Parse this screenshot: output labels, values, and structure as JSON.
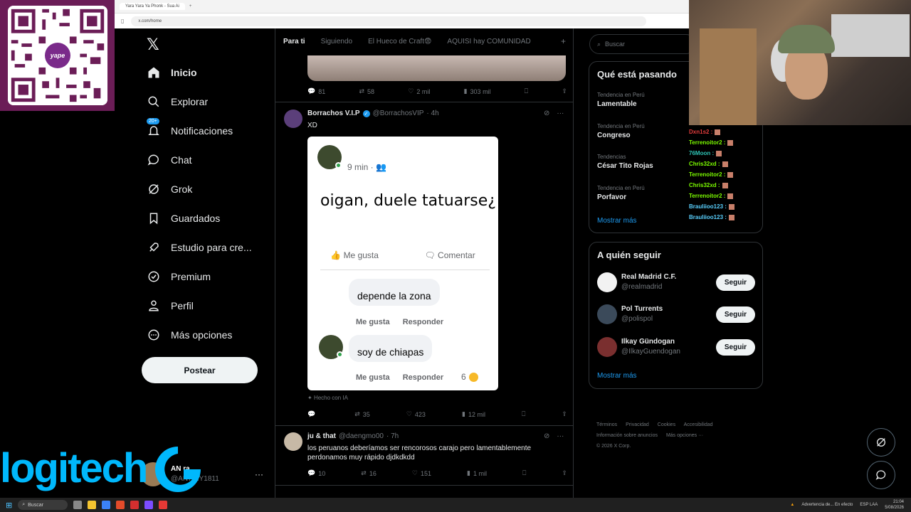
{
  "browser": {
    "tab_title": "Yara Yara Ya Phonk - Sua Ai",
    "url": "x.com/home"
  },
  "qr": {
    "logo_text": "yape"
  },
  "nav": {
    "items": [
      {
        "label": "Inicio",
        "icon": "home-icon"
      },
      {
        "label": "Explorar",
        "icon": "search-icon"
      },
      {
        "label": "Notificaciones",
        "icon": "bell-icon",
        "badge": "20+"
      },
      {
        "label": "Chat",
        "icon": "chat-icon"
      },
      {
        "label": "Grok",
        "icon": "grok-icon"
      },
      {
        "label": "Guardados",
        "icon": "bookmark-icon"
      },
      {
        "label": "Estudio para cre...",
        "icon": "rocket-icon"
      },
      {
        "label": "Premium",
        "icon": "premium-icon"
      },
      {
        "label": "Perfil",
        "icon": "person-icon"
      },
      {
        "label": "Más opciones",
        "icon": "more-circle-icon"
      }
    ],
    "post_label": "Postear",
    "account_name": "AN      ra",
    "account_handle": "@AN7       NY1811"
  },
  "tabs": [
    "Para ti",
    "Siguiendo",
    "El Hueco de Craft😨",
    "AQUISI hay COMUNIDAD"
  ],
  "tweets": [
    {
      "actions": {
        "replies": "81",
        "retweets": "58",
        "likes": "2 mil",
        "views": "303 mil"
      }
    },
    {
      "name": "Borrachos V.I.P",
      "handle": "@BorrachosVIP",
      "time": "· 4h",
      "text": "XD",
      "ai_tag": "Hecho con IA",
      "actions": {
        "replies": "",
        "retweets": "35",
        "likes": "423",
        "views": "12 mil"
      },
      "fb": {
        "time": "9 min ·",
        "post_text": "oigan, duele tatuarse¿",
        "like": "Me gusta",
        "comment": "Comentar",
        "comment1": "depende la zona",
        "comment2": "soy de chiapas",
        "reply_like": "Me gusta",
        "reply": "Responder",
        "reactions": "6"
      }
    },
    {
      "name": "ju & that",
      "handle": "@daengmo00",
      "time": "· 7h",
      "text": "los peruanos deberíamos ser rencorosos carajo pero lamentablemente perdonamos muy rápido djdkdkdd",
      "actions": {
        "replies": "10",
        "retweets": "16",
        "likes": "151",
        "views": "1 mil"
      }
    }
  ],
  "search": {
    "placeholder": "Buscar"
  },
  "trends": {
    "title": "Qué está pasando",
    "items": [
      {
        "context": "Tendencia en Perú",
        "topic": "Lamentable"
      },
      {
        "context": "Tendencia en Perú",
        "topic": "Congreso"
      },
      {
        "context": "Tendencias",
        "topic": "César Tito Rojas"
      },
      {
        "context": "Tendencia en Perú",
        "topic": "Porfavor"
      }
    ],
    "show_more": "Mostrar más"
  },
  "who_to_follow": {
    "title": "A quién seguir",
    "items": [
      {
        "name": "Real Madrid C.F.",
        "handle": "@realmadrid",
        "button": "Seguir"
      },
      {
        "name": "Pol Turrents",
        "handle": "@polispol",
        "button": "Seguir"
      },
      {
        "name": "Ilkay Gündogan",
        "handle": "@IlkayGuendogan",
        "button": "Seguir"
      }
    ],
    "show_more": "Mostrar más"
  },
  "footer": {
    "links": [
      "Términos",
      "Privacidad",
      "Cookies",
      "Accesibilidad",
      "Información sobre anuncios",
      "Más opciones ···"
    ],
    "copyright": "© 2026 X Corp."
  },
  "chat_overlay": [
    {
      "user": "Dxn1s2 :",
      "color": "#e23c3c"
    },
    {
      "user": "Terrenoitor2 :",
      "color": "#7cfc00"
    },
    {
      "user": "76Moon :",
      "color": "#2ec4b6"
    },
    {
      "user": "Chris32xd :",
      "color": "#7cfc00"
    },
    {
      "user": "Terrenoitor2 :",
      "color": "#7cfc00"
    },
    {
      "user": "Chris32xd :",
      "color": "#7cfc00"
    },
    {
      "user": "Terrenoitor2 :",
      "color": "#7cfc00"
    },
    {
      "user": "Brauliioo123 :",
      "color": "#5ad1ff"
    },
    {
      "user": "Brauliioo123 :",
      "color": "#5ad1ff"
    }
  ],
  "logitech": {
    "text": "logitech"
  },
  "taskbar": {
    "search": "Buscar",
    "warning": "Advertencia de... En efecto",
    "lang": "ESP LAA",
    "time": "21:04",
    "date": "5/08/2026"
  },
  "colors": {
    "accent": "#1d9bf0",
    "bg": "#000000",
    "logitech": "#00b8fc"
  }
}
